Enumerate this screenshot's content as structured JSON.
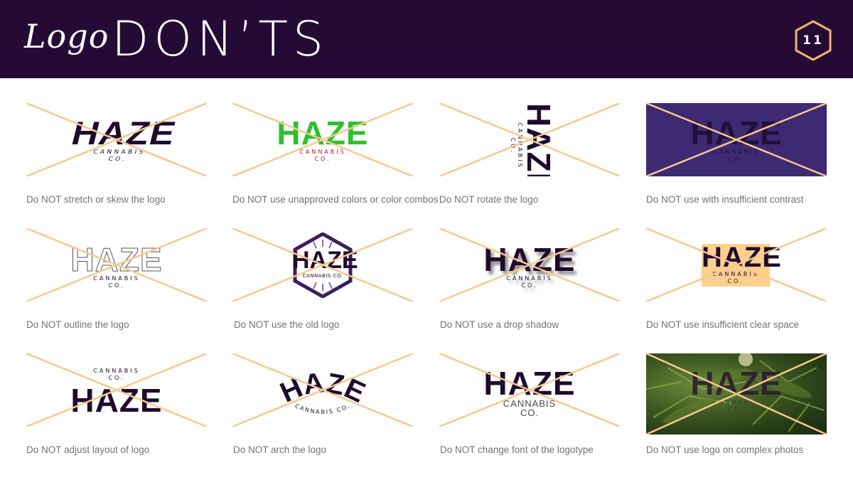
{
  "header": {
    "title_script": "Logo",
    "title_main": "DON’TS",
    "page_number": "11",
    "background": "#260a36",
    "badge_color": "#e9b96a"
  },
  "cross_color": "#f7c98e",
  "caption_color": "#737373",
  "logo_text": {
    "word": "HAZE",
    "sub_line1": "CANNABIS",
    "sub_line2": "CO.",
    "sub_combined": "CANNABIS CO."
  },
  "tiles": [
    {
      "caption": "Do NOT stretch or skew the logo"
    },
    {
      "caption": "Do NOT use unapproved colors or color combos"
    },
    {
      "caption": "Do NOT rotate the logo"
    },
    {
      "caption": "Do NOT use with insufficient contrast"
    },
    {
      "caption": "Do NOT outline the logo"
    },
    {
      "caption": "Do NOT use the old logo"
    },
    {
      "caption": "Do NOT use a drop shadow"
    },
    {
      "caption": "Do NOT use insufficient clear space"
    },
    {
      "caption": "Do NOT adjust layout of logo"
    },
    {
      "caption": "Do NOT arch the logo"
    },
    {
      "caption": "Do NOT change font of the logotype"
    },
    {
      "caption": "Do NOT use logo on complex photos"
    }
  ]
}
